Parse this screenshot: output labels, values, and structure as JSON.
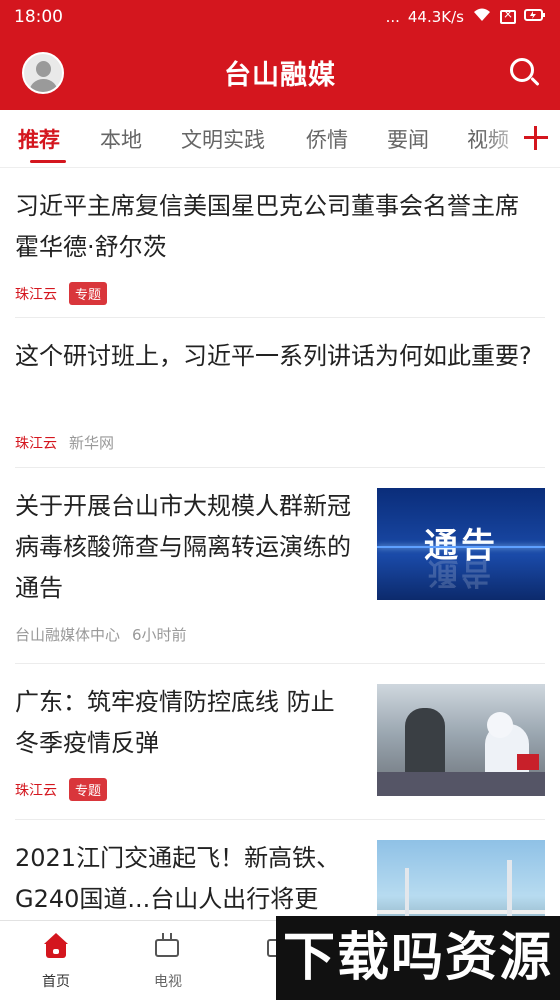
{
  "status_bar": {
    "time": "18:00",
    "net_speed": "44.3K/s",
    "signal_dots": "..."
  },
  "app_bar": {
    "title": "台山融媒",
    "icons": [
      "avatar",
      "search-icon"
    ]
  },
  "tabs": [
    {
      "label": "推荐",
      "active": true
    },
    {
      "label": "本地"
    },
    {
      "label": "文明实践"
    },
    {
      "label": "侨情"
    },
    {
      "label": "要闻"
    },
    {
      "label": "视频"
    }
  ],
  "feed": [
    {
      "title": "习近平主席复信美国星巴克公司董事会名誉主席霍华德·舒尔茨",
      "source": "珠江云",
      "tag": "专题"
    },
    {
      "title": "这个研讨班上，习近平一系列讲话为何如此重要?",
      "source": "珠江云",
      "source2": "新华网"
    },
    {
      "title": "关于开展台山市大规模人群新冠病毒核酸筛查与隔离转运演练的通告",
      "source": "台山融媒体中心",
      "time": "6小时前",
      "thumb_text": "通告"
    },
    {
      "title": "广东：筑牢疫情防控底线 防止冬季疫情反弹",
      "source": "珠江云",
      "tag": "专题"
    },
    {
      "title": "2021江门交通起飞！新高铁、G240国道...台山人出行将更"
    }
  ],
  "bottom_nav": [
    {
      "label": "首页",
      "active": true,
      "icon": "home-icon"
    },
    {
      "label": "电视",
      "icon": "tv-icon"
    },
    {
      "label": "",
      "icon": "live-icon"
    }
  ],
  "watermark": "下载吗资源",
  "colors": {
    "brand": "#d4161e"
  }
}
